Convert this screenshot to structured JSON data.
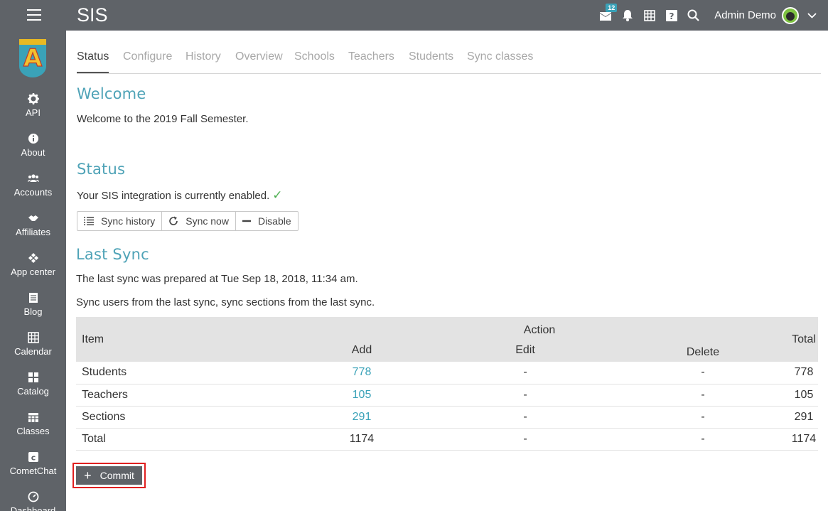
{
  "app": {
    "title": "SIS",
    "user_name": "Admin Demo",
    "notification_count": "12"
  },
  "sidebar": {
    "items": [
      {
        "label": "API",
        "icon": "gear-icon"
      },
      {
        "label": "About",
        "icon": "info-icon"
      },
      {
        "label": "Accounts",
        "icon": "users-icon"
      },
      {
        "label": "Affiliates",
        "icon": "handshake-icon"
      },
      {
        "label": "App center",
        "icon": "app-center-icon"
      },
      {
        "label": "Blog",
        "icon": "blog-icon"
      },
      {
        "label": "Calendar",
        "icon": "calendar-icon"
      },
      {
        "label": "Catalog",
        "icon": "catalog-icon"
      },
      {
        "label": "Classes",
        "icon": "classes-icon"
      },
      {
        "label": "CometChat",
        "icon": "cometchat-icon"
      },
      {
        "label": "Dashboard",
        "icon": "dashboard-icon"
      }
    ]
  },
  "tabs": [
    {
      "label": "Status",
      "active": true
    },
    {
      "label": "Configure",
      "active": false
    },
    {
      "label": "History",
      "active": false
    },
    {
      "label": "Overview",
      "active": false
    },
    {
      "label": "Schools",
      "active": false
    },
    {
      "label": "Teachers",
      "active": false
    },
    {
      "label": "Students",
      "active": false
    },
    {
      "label": "Sync classes",
      "active": false
    }
  ],
  "welcome": {
    "heading": "Welcome",
    "text": "Welcome to the 2019 Fall Semester."
  },
  "status": {
    "heading": "Status",
    "text": "Your SIS integration is currently enabled.",
    "check": "✓",
    "buttons": {
      "sync_history": "Sync history",
      "sync_now": "Sync now",
      "disable": "Disable"
    }
  },
  "last_sync": {
    "heading": "Last Sync",
    "prepared_text": "The last sync was prepared at Tue Sep 18, 2018, 11:34 am.",
    "description": "Sync users from the last sync, sync sections from the last sync.",
    "table": {
      "headers": {
        "item": "Item",
        "action": "Action",
        "add": "Add",
        "edit": "Edit",
        "delete": "Delete",
        "total": "Total"
      },
      "rows": [
        {
          "item": "Students",
          "add": "778",
          "edit": "-",
          "delete": "-",
          "total": "778"
        },
        {
          "item": "Teachers",
          "add": "105",
          "edit": "-",
          "delete": "-",
          "total": "105"
        },
        {
          "item": "Sections",
          "add": "291",
          "edit": "-",
          "delete": "-",
          "total": "291"
        },
        {
          "item": "Total",
          "add": "1174",
          "edit": "-",
          "delete": "-",
          "total": "1174"
        }
      ]
    },
    "commit_label": "Commit"
  },
  "colors": {
    "chrome": "#5f6368",
    "accent": "#3aa2b8",
    "heading": "#4fa3b7",
    "highlight": "#e02020"
  }
}
